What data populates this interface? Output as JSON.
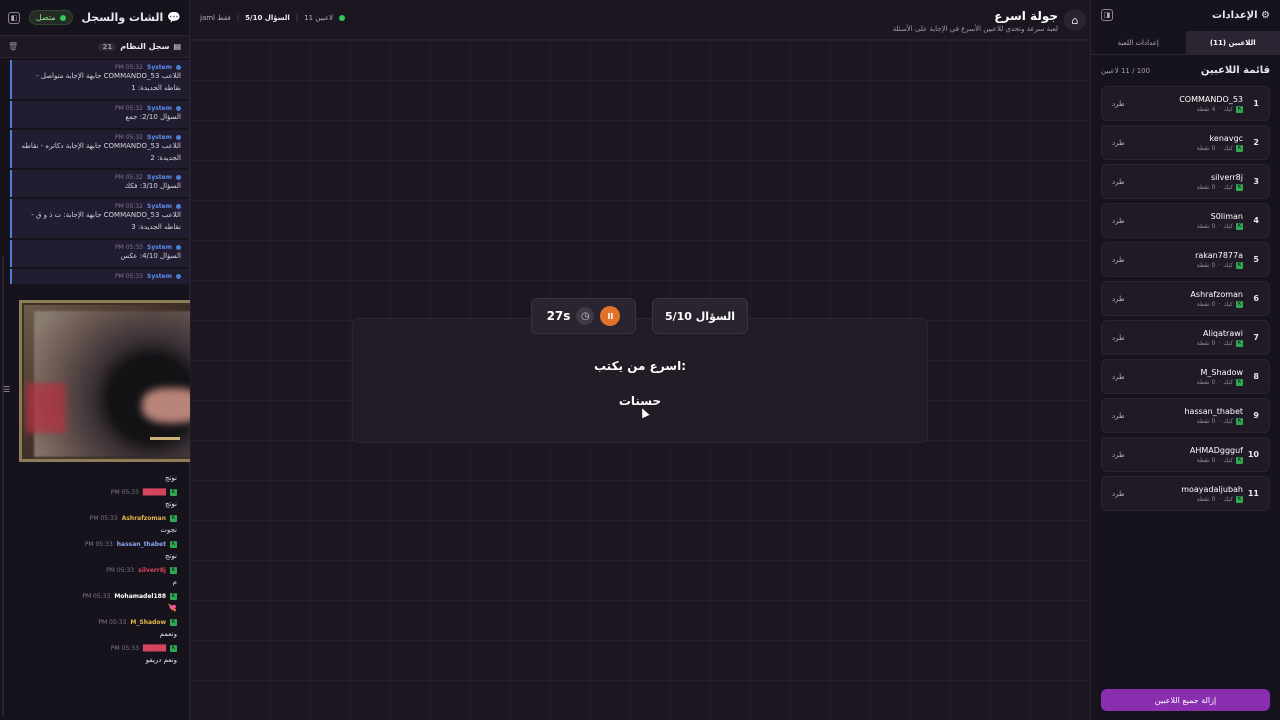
{
  "chat": {
    "title": "الشات والسجل",
    "status": "متصل",
    "log_title": "سجل النظام",
    "log_count": "21",
    "system_messages": [
      {
        "who": "System",
        "time": "PM 05:32",
        "text": "اللاعب COMMANDO_53 جابهة الإجابة متواصل - نقاطه الجديدة: 1"
      },
      {
        "who": "System",
        "time": "PM 05:32",
        "text": "السؤال 2/10: جمع"
      },
      {
        "who": "System",
        "time": "PM 05:32",
        "text": "اللاعب COMMANDO_53 جابهة الإجابة دكاتره - نقاطه الجديدة: 2"
      },
      {
        "who": "System",
        "time": "PM 05:32",
        "text": "السؤال 3/10: فكك"
      },
      {
        "who": "System",
        "time": "PM 05:32",
        "text": "اللاعب COMMANDO_53 جابهة الإجابة: ت ذ و ق - نقاطه الجديدة: 3"
      },
      {
        "who": "System",
        "time": "PM 05:33",
        "text": "السؤال 4/10: عكس"
      },
      {
        "who": "System",
        "time": "PM 05:33",
        "text": ""
      }
    ],
    "user_messages": [
      {
        "name": "",
        "time": "",
        "text": "نوتج",
        "color": "#e0b64a"
      },
      {
        "name": "",
        "time": "PM 05:33",
        "text": "نوتج",
        "color": "#d6455e"
      },
      {
        "name": "Ashrafzoman",
        "time": "PM 05:33",
        "text": "نجوت",
        "color": "#e0b64a"
      },
      {
        "name": "hassan_thabet",
        "time": "PM 05:33",
        "text": "نوتج",
        "color": "#8aa6ef"
      },
      {
        "name": "silverr8j",
        "time": "PM 05:33",
        "text": "م",
        "color": "#d6455e"
      },
      {
        "name": "Mohamadel188",
        "time": "PM 05:33",
        "text": "💘",
        "color": "#ffffff"
      },
      {
        "name": "M_Shadow",
        "time": "PM 05:33",
        "text": "ونعمم",
        "color": "#e0b64a"
      },
      {
        "name": "",
        "time": "PM 05:33",
        "text": "ونعم دريفو",
        "color": "#d6455e"
      }
    ],
    "side_tab": "☰"
  },
  "topbar": {
    "players": "11 لاعبين",
    "question": "السؤال 5/10",
    "extra": "jaml فقط",
    "title": "جولة اسرع",
    "subtitle": "لعبة سرعة وتحدي للاعبين الأسرع في الإجابة على الأسئلة"
  },
  "stage": {
    "question_label": "السؤال 5/10",
    "timer": "27s",
    "prompt": "اسرع من يكتب:",
    "word": "حسنات"
  },
  "settings": {
    "title": "الإعدادات",
    "tabs": [
      "اللاعبين (11)",
      "إعدادات اللعبة"
    ],
    "list_title": "قائمة اللاعبين",
    "list_count": "100 / 11 لاعبين",
    "kick_label": "طرد",
    "remove_all": "إزالة جميع اللاعبين",
    "players": [
      {
        "rank": "1",
        "name": "COMMANDO_53",
        "platform": "كيك",
        "points": "4 نقطة"
      },
      {
        "rank": "2",
        "name": "kenavgc",
        "platform": "كيك",
        "points": "0 نقطة"
      },
      {
        "rank": "3",
        "name": "silverr8j",
        "platform": "كيك",
        "points": "0 نقطة"
      },
      {
        "rank": "4",
        "name": "S0liman",
        "platform": "كيك",
        "points": "0 نقطة"
      },
      {
        "rank": "5",
        "name": "rakan7877a",
        "platform": "كيك",
        "points": "0 نقطة"
      },
      {
        "rank": "6",
        "name": "Ashrafzoman",
        "platform": "كيك",
        "points": "0 نقطة"
      },
      {
        "rank": "7",
        "name": "Aliqatrawi",
        "platform": "كيك",
        "points": "0 نقطة"
      },
      {
        "rank": "8",
        "name": "M_Shadow",
        "platform": "كيك",
        "points": "0 نقطة"
      },
      {
        "rank": "9",
        "name": "hassan_thabet",
        "platform": "كيك",
        "points": "0 نقطة"
      },
      {
        "rank": "10",
        "name": "AHMADggguf",
        "platform": "كيك",
        "points": "0 نقطة"
      },
      {
        "rank": "11",
        "name": "moayadaljubah",
        "platform": "كيك",
        "points": "0 نقطة"
      }
    ]
  },
  "colors": {
    "accent": "#8a2eb0",
    "timer": "#e0712a",
    "system": "#4c7fd6",
    "online": "#35c759"
  }
}
